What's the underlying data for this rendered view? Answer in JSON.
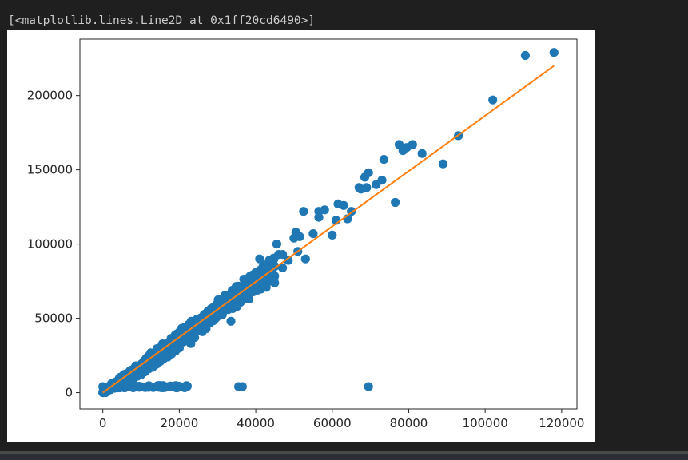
{
  "cell_output": {
    "repr_text": "[<matplotlib.lines.Line2D at 0x1ff20cd6490>]"
  },
  "chart_data": {
    "type": "scatter",
    "title": "",
    "xlabel": "",
    "ylabel": "",
    "xlim": [
      -6000,
      124000
    ],
    "ylim": [
      -11000,
      238000
    ],
    "xticks": [
      0,
      20000,
      40000,
      60000,
      80000,
      100000,
      120000
    ],
    "yticks": [
      0,
      50000,
      100000,
      150000,
      200000
    ],
    "xtick_labels": [
      "0",
      "20000",
      "40000",
      "60000",
      "80000",
      "100000",
      "120000"
    ],
    "ytick_labels": [
      "0",
      "50000",
      "100000",
      "150000",
      "200000"
    ],
    "grid": false,
    "series": [
      {
        "kind": "scatter",
        "color": "#1f77b4",
        "x": [
          118000,
          110500,
          102000,
          93000,
          89000,
          83500,
          81000,
          79500,
          77500,
          78500,
          76500,
          73500,
          73000,
          71500,
          69500,
          69000,
          68500,
          67000,
          67500,
          65000,
          64000,
          63000,
          61500,
          61000,
          60000,
          58000,
          56500,
          55000,
          52500,
          51500,
          50500,
          50000,
          48500,
          47000,
          46000,
          45500,
          45000,
          43500,
          42000,
          41000,
          40000,
          39000,
          38000,
          37000,
          36000,
          35000,
          34000,
          33500,
          33000,
          32000,
          31000,
          30000,
          29000,
          28000,
          27000,
          26000,
          25000,
          24000,
          23000,
          22000,
          21000,
          20000,
          19000,
          18000,
          17000,
          16000,
          15000,
          14000,
          13000,
          12000,
          11000,
          10000,
          9000,
          8000,
          7000,
          6000,
          5000,
          4000,
          3000,
          2000,
          1000,
          500,
          0,
          40000,
          47000,
          51000,
          30000,
          28000,
          25000,
          21000,
          17000,
          13000,
          8000,
          44000,
          53000,
          56500,
          69500,
          35500,
          36500,
          22000,
          20000,
          18000,
          16000,
          14000,
          12000,
          10000,
          8000,
          6000,
          4000,
          2000,
          0
        ],
        "y": [
          229000,
          227000,
          197000,
          173000,
          154000,
          161000,
          167000,
          165000,
          167000,
          163000,
          128000,
          157000,
          143000,
          140000,
          148000,
          138000,
          145000,
          138000,
          137000,
          122000,
          117000,
          126000,
          127000,
          116000,
          106000,
          123000,
          122000,
          107000,
          122000,
          105000,
          108000,
          104000,
          89000,
          93000,
          93000,
          100000,
          85000,
          84000,
          86000,
          90000,
          78000,
          73000,
          72000,
          68000,
          68000,
          64000,
          59000,
          48000,
          62000,
          56000,
          55000,
          53000,
          49000,
          47000,
          43000,
          41000,
          43000,
          37000,
          33000,
          35000,
          34000,
          30000,
          28000,
          26000,
          24000,
          23000,
          21000,
          19000,
          17000,
          16000,
          14000,
          12000,
          11000,
          9000,
          7000,
          6000,
          5000,
          4000,
          3000,
          2000,
          1000,
          500,
          0,
          73000,
          84000,
          95000,
          57000,
          54000,
          47000,
          40000,
          32000,
          23000,
          15000,
          80000,
          90000,
          118000,
          4000,
          4000,
          4000,
          4000,
          4000,
          4000,
          4000,
          4000,
          4000,
          4000,
          4000,
          4000,
          4000,
          4000,
          4000
        ],
        "cluster_band": {
          "x_start": 0,
          "x_end": 45000,
          "slope_low": 1.67,
          "slope_high": 2.05,
          "jitter": 1500
        }
      },
      {
        "kind": "line",
        "color": "#ff7f0e",
        "x": [
          0,
          118000
        ],
        "y": [
          0,
          220000
        ]
      }
    ]
  }
}
